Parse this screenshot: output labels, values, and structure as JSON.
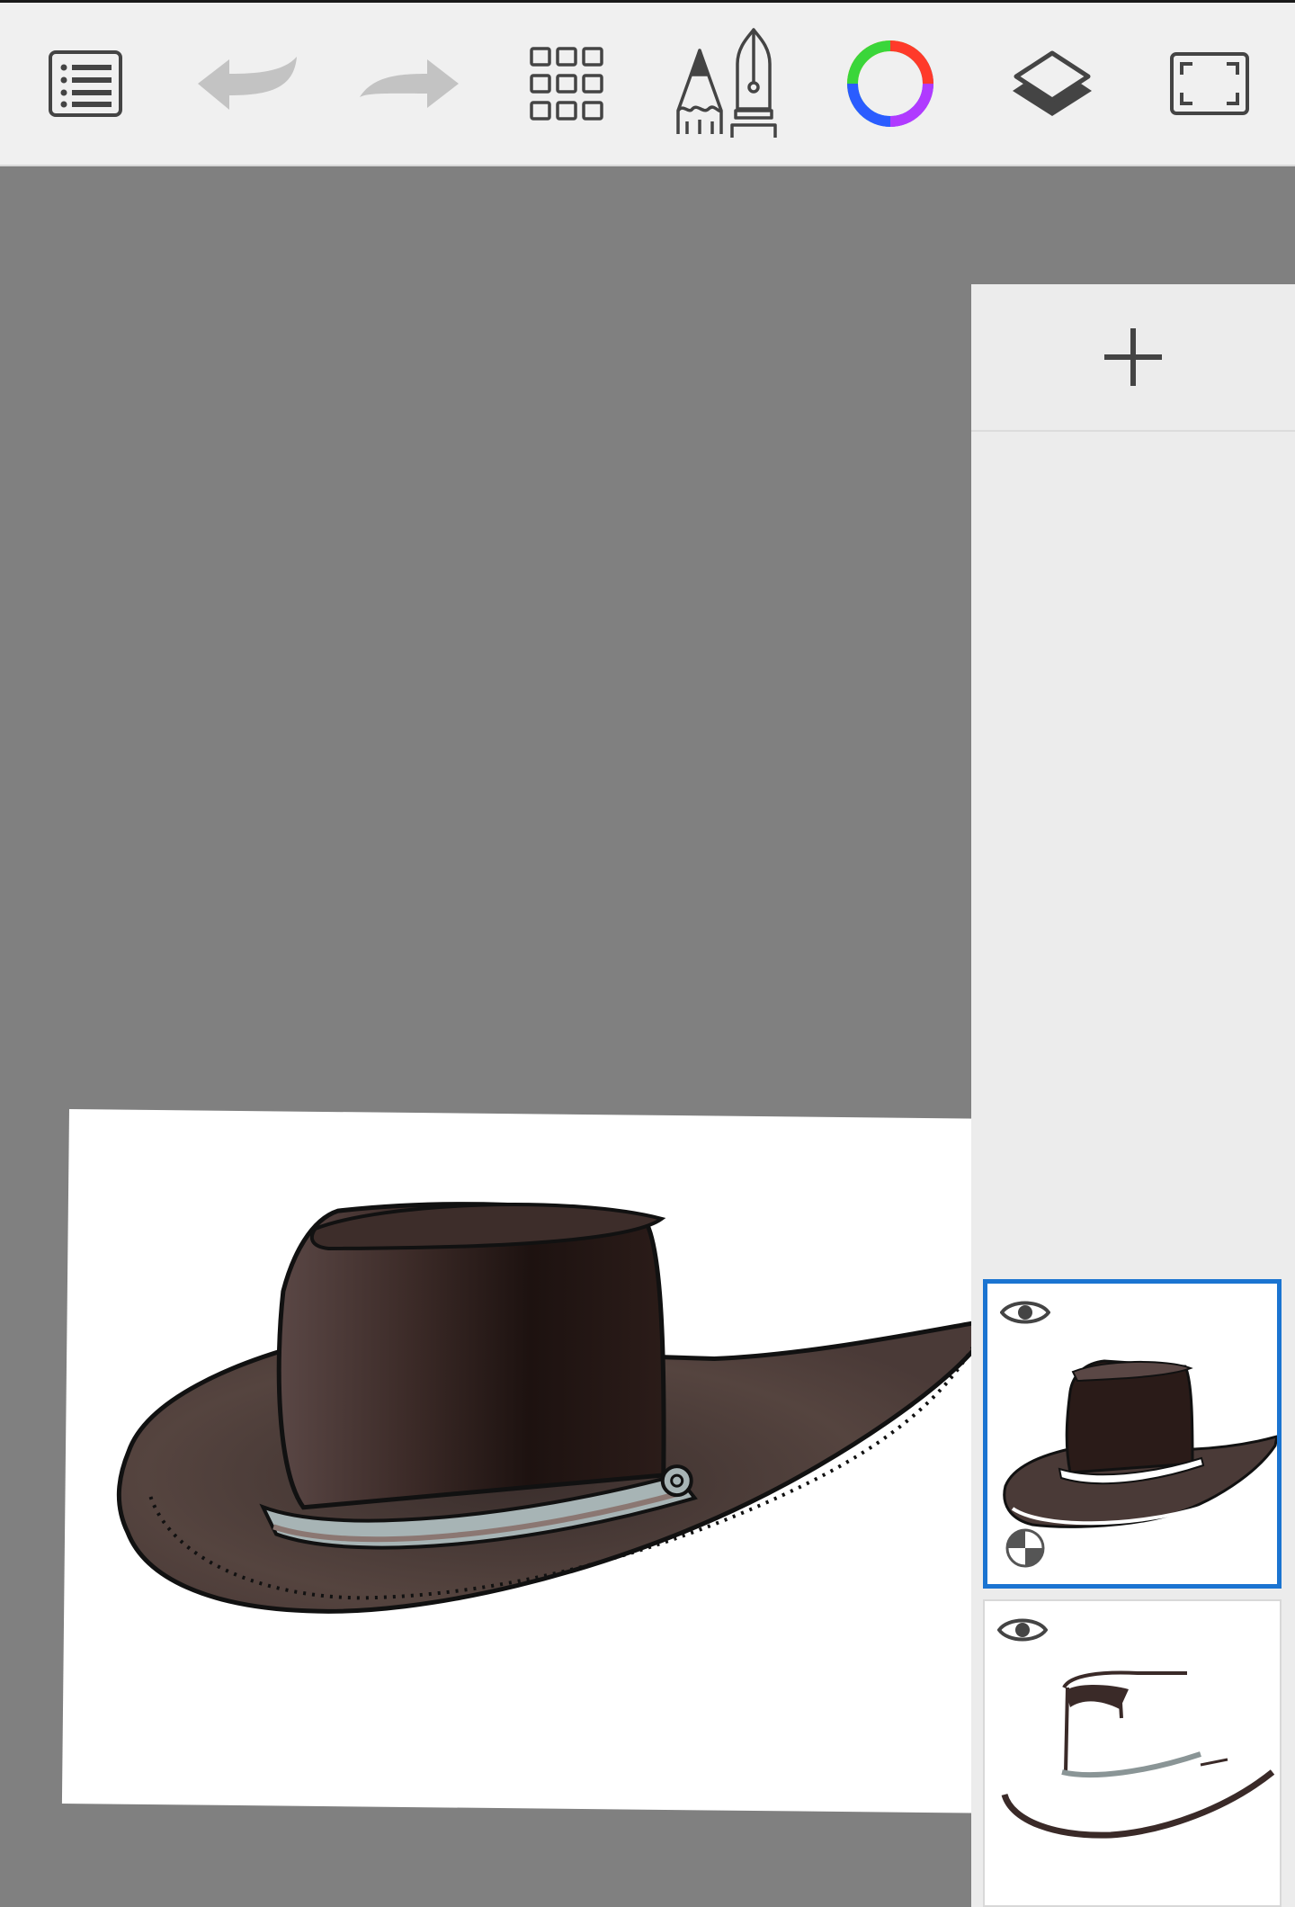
{
  "app": {
    "toolbar": {
      "items": [
        {
          "name": "menu-list-icon"
        },
        {
          "name": "undo-icon",
          "enabled": false
        },
        {
          "name": "redo-icon",
          "enabled": false
        },
        {
          "name": "grid-gallery-icon"
        },
        {
          "name": "brush-pen-tools-icon"
        },
        {
          "name": "color-wheel-icon"
        },
        {
          "name": "layers-icon"
        },
        {
          "name": "fullscreen-icon"
        }
      ]
    },
    "colors": {
      "toolbar_bg": "#f0f0f0",
      "canvas_bg": "#808080",
      "panel_bg": "#ececec",
      "selection": "#1b74d1",
      "hat_brown": "#4a3a38",
      "hat_dark": "#1f1412",
      "band": "#a9b9bb"
    },
    "layers_panel": {
      "add_icon": "plus-icon",
      "layers": [
        {
          "name": "hat-colored-layer",
          "selected": true,
          "visible": true,
          "visibility_icon": "eye-icon",
          "blend_icon": "checker-icon"
        },
        {
          "name": "hat-sketch-layer",
          "selected": false,
          "visible": true,
          "visibility_icon": "eye-icon"
        }
      ]
    },
    "canvas": {
      "artwork": "cowboy-hat-drawing"
    }
  }
}
